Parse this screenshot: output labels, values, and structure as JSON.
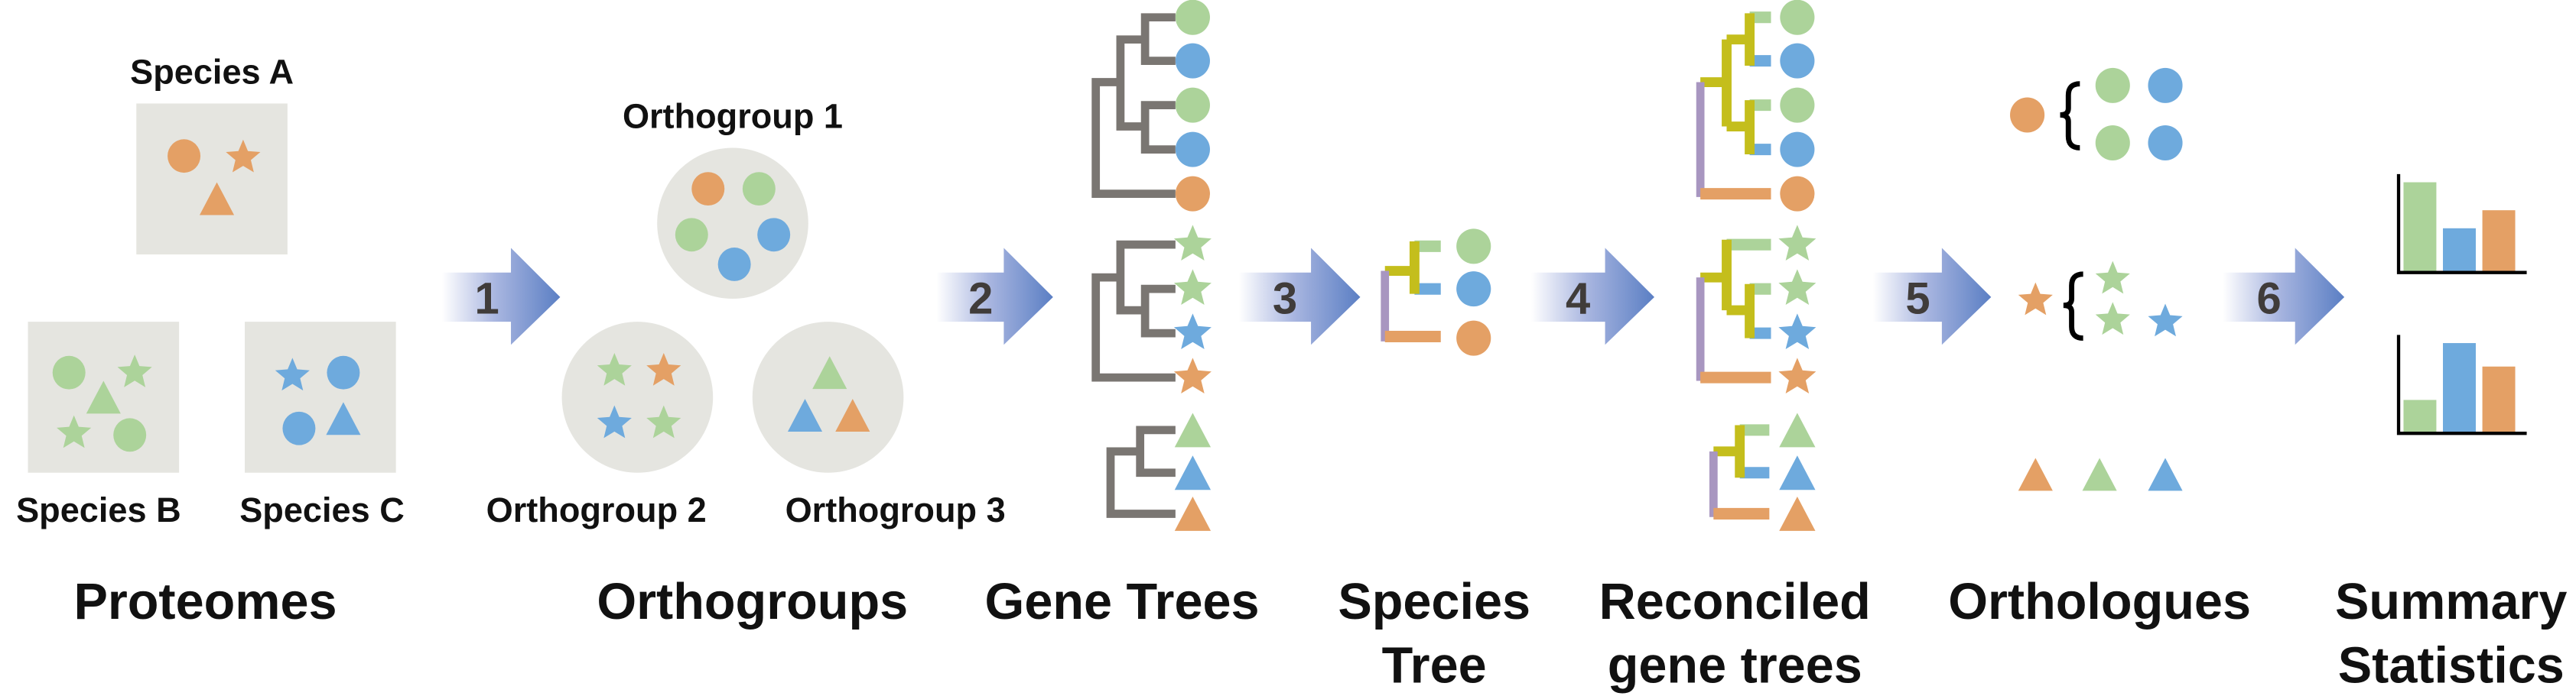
{
  "colors": {
    "species_a": "#e4a065",
    "species_b": "#acd39a",
    "species_c": "#6eaadd",
    "box": "#e5e5e0",
    "gene_tree": "#7a7672",
    "duplication_branch": "#c4be1c",
    "root_branch": "#a896c0",
    "arrow_end": "#5b7fc4"
  },
  "proteomes": {
    "species_a": "Species A",
    "species_b": "Species B",
    "species_c": "Species C",
    "title": "Proteomes"
  },
  "orthogroups": {
    "og1": "Orthogroup 1",
    "og2": "Orthogroup 2",
    "og3": "Orthogroup 3",
    "title": "Orthogroups"
  },
  "gene_trees": {
    "title": "Gene Trees"
  },
  "species_tree": {
    "title_line1": "Species",
    "title_line2": "Tree"
  },
  "reconciled": {
    "title_line1": "Reconciled",
    "title_line2": "gene trees"
  },
  "orthologues": {
    "title": "Orthologues"
  },
  "summary": {
    "title_line1": "Summary",
    "title_line2": "Statistics"
  },
  "steps": [
    "1",
    "2",
    "3",
    "4",
    "5",
    "6"
  ],
  "chart_data": [
    {
      "type": "bar",
      "categories": [
        "Species B",
        "Species C",
        "Species A"
      ],
      "values": [
        1.0,
        0.49,
        0.69
      ]
    },
    {
      "type": "bar",
      "categories": [
        "Species B",
        "Species C",
        "Species A"
      ],
      "values": [
        0.37,
        1.0,
        0.74
      ]
    }
  ]
}
